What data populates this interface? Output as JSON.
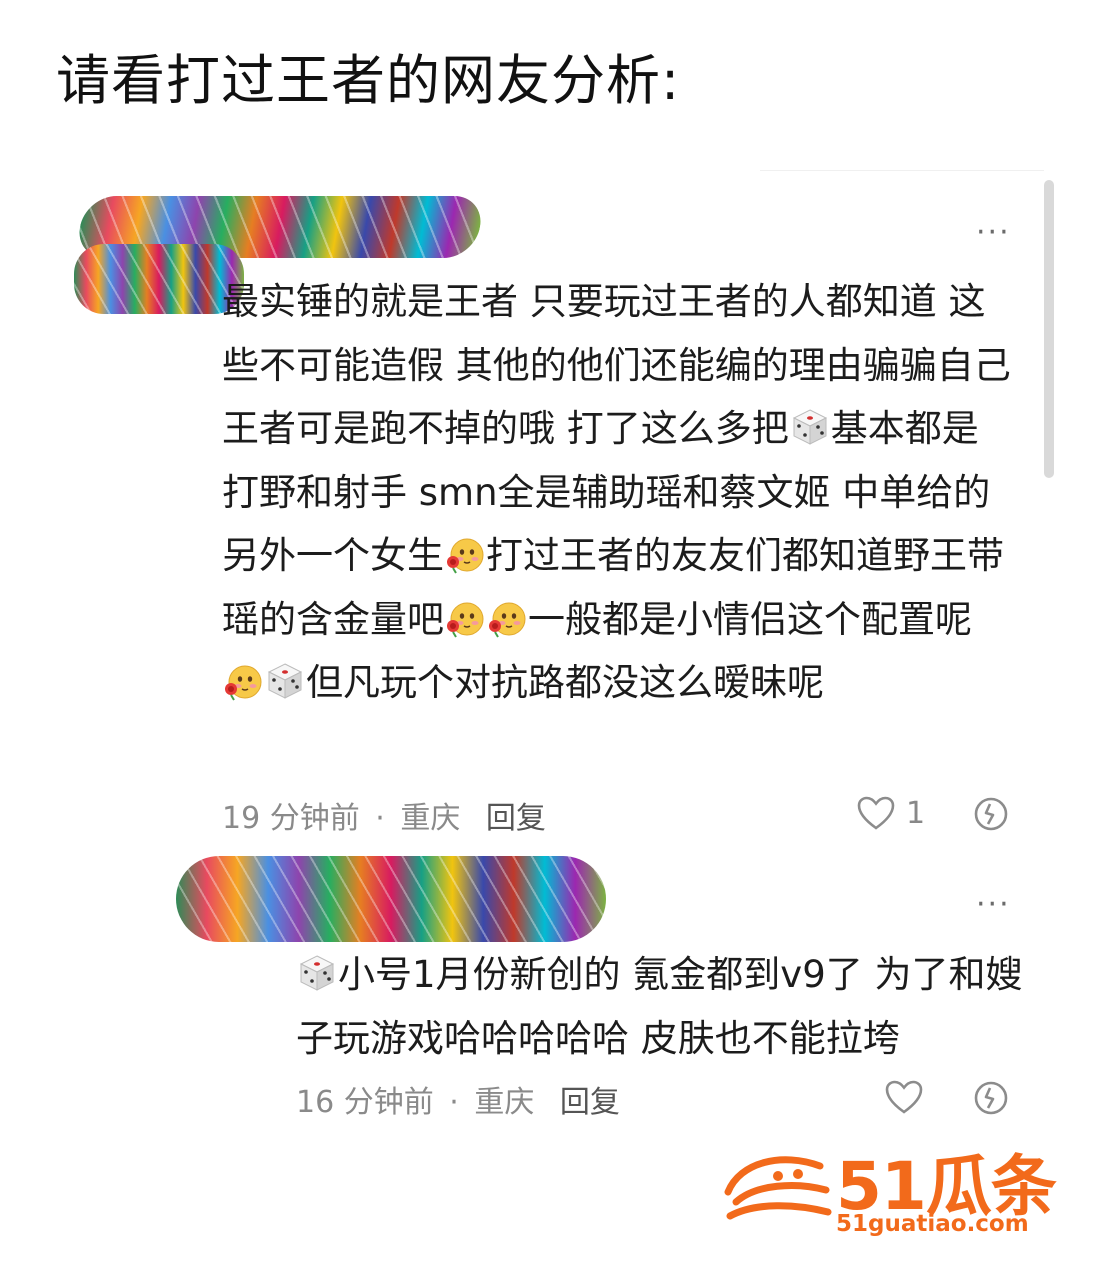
{
  "headline": "请看打过王者的网友分析:",
  "comments": [
    {
      "more": "···",
      "segments": [
        {
          "t": "最实锤的就是王者 只要玩过王者的人都知道 这些不可能造假 其他的他们还能编的理由骗骗自己 王者可是跑不掉的哦 打了这么多把"
        },
        {
          "e": "dice"
        },
        {
          "t": "基本都是打野和射手 smn全是辅助瑶和蔡文姬 中单给的另外一个女生"
        },
        {
          "e": "rose-face"
        },
        {
          "t": "打过王者的友友们都知道野王带瑶的含金量吧"
        },
        {
          "e": "rose-face"
        },
        {
          "e": "rose-face"
        },
        {
          "t": "一般都是小情侣这个配置呢"
        },
        {
          "e": "rose-face"
        },
        {
          "e": "dice"
        },
        {
          "t": "但凡玩个对抗路都没这么暧昧呢"
        }
      ],
      "time": "19 分钟前",
      "sep": "·",
      "location": "重庆",
      "reply": "回复",
      "likes": "1"
    },
    {
      "more": "···",
      "segments": [
        {
          "e": "dice"
        },
        {
          "t": "小号1月份新创的 氪金都到v9了 为了和嫂子玩游戏哈哈哈哈哈 皮肤也不能拉垮"
        }
      ],
      "time": "16 分钟前",
      "sep": "·",
      "location": "重庆",
      "reply": "回复",
      "likes": ""
    }
  ],
  "watermark": {
    "brand": "51瓜条",
    "url": "51guatiao.com",
    "color": "#f26a1b"
  },
  "icons": {
    "dice": "dice-emoji-icon",
    "rose-face": "rose-face-emoji-icon",
    "heart": "heart-icon",
    "dislike": "broken-heart-icon"
  }
}
